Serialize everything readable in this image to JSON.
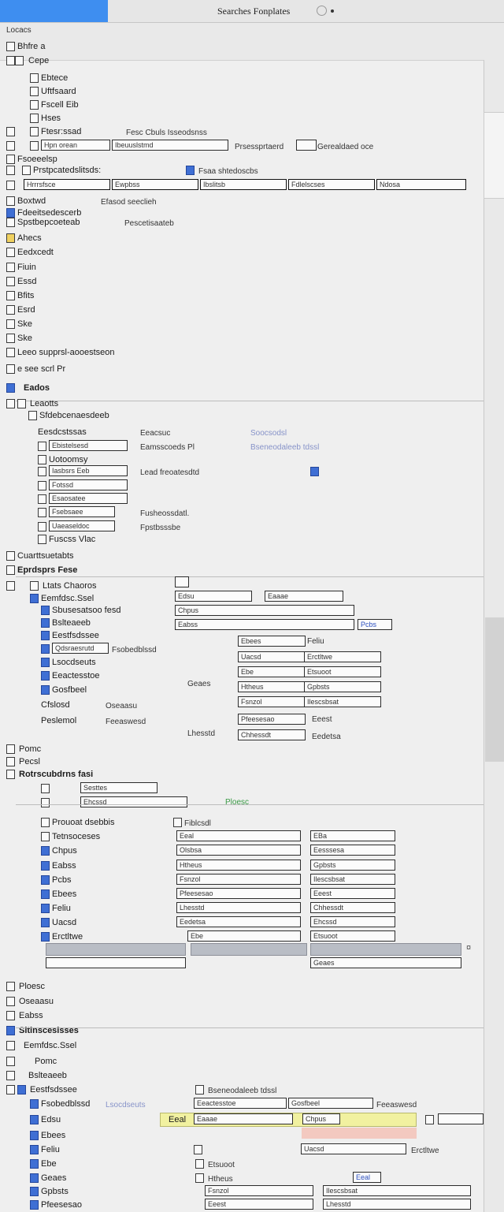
{
  "window": {
    "title": "Searches Fonplates",
    "breadcrumb": "Locacs"
  },
  "colors": {
    "accent": "#3e8ef0",
    "checked": "#3f6fd4",
    "highlight": "#f1f1a0",
    "link": "#2b4fbf"
  },
  "tree": {
    "root": "Bhfre a",
    "group": "Cepe",
    "items_a": [
      "Ebtece",
      "Uftfsaard",
      "Fscell Eib",
      "Hses",
      "Ftesr:ssad",
      "Fsoeeelsp",
      "Boxtwd"
    ],
    "items_b": [
      "Ahecs",
      "Eedxcedt",
      "Fiuin",
      "Essd",
      "Bfits",
      "Esrd",
      "Ske"
    ],
    "support_row": "Leeo supprsl-aooestseon",
    "row_b": "e see scrl Pr",
    "section_a": "Eados",
    "section_a_sub": "Leaotts",
    "section_b": "Cuarttsuetabts",
    "section_c": "Eprdsprs Fese",
    "section_c_sub": "Ltats Chaoros",
    "section_d": "Rotrscubdrns fasi",
    "section_e": "Prouoat dsebbis",
    "section_f": "Tetnsoceses",
    "section_g": "Pomc",
    "section_h": "Sitinsceslsses",
    "section_i": "Pecsl"
  },
  "fields": {
    "f1": "Hpn orean",
    "f2": "Ibeuuslstmd",
    "f3": "Hrrrsfsce",
    "f4": "Ewpbss",
    "f5": "Ibslitsb",
    "f6": "Fdlelscses",
    "f7": "Ndosa",
    "f8": "Eesdcstssas",
    "f9": "Ebistelsesd",
    "f10": "Uotoomsy",
    "f11": "Iasbsrs Eeb",
    "f12": "Fotssd",
    "f13": "Esaosatee",
    "f14": "Fsebsaee",
    "f15": "Uaeaseldoc",
    "f16": "Fuscss Vlac",
    "f17": "Qdsraesrutd",
    "f18": "Cfslosd",
    "f19": "Peslemol",
    "f20": "Sesttes"
  },
  "notes": {
    "n1": "Fesc Cbuls Isseodsnss",
    "n2": "Prsessprtaerd",
    "n3": "Gerealdaed oce",
    "n4": "Prstpcatedslitsds:",
    "n5": "Fsaa shtedoscbs",
    "n6": "Efasod seeclieh",
    "n7": "Fdeeitsedescerb",
    "n8": "Spstbepcoeteab",
    "n9": "Pescetisaateb",
    "n10": "Sfdebcenaesdeeb",
    "n11": "Eeacsuc",
    "n12": "Soocsodsl",
    "n13": "Eamsscoeds Pl",
    "n14": "Bseneodaleeb tdssl",
    "n15": "Lead freoatesdtd",
    "n16": "Fusheossdatl.",
    "n17": "Fpstbsssbe",
    "n18": "Eemfdsc.Ssel",
    "n19": "Sbusesatsoo fesd",
    "n20": "Bslteaeeb",
    "n21": "Eestfsdssee",
    "n22": "Fsobedblssd",
    "n23": "Lsocdseuts",
    "n24": "Eeactesstoe",
    "n25": "Gosfbeel",
    "n26": "Oseaasu",
    "n27": "Feeaswesd",
    "n28": "Edsu",
    "n29": "Eaaae",
    "n30": "Chpus",
    "n31": "Eabss",
    "n32": "Pcbs",
    "n33": "Ebees",
    "n34": "Feliu",
    "n35": "Uacsd",
    "n36": "Erctltwe",
    "n37": "Ebe",
    "n38": "Etsuoot",
    "n39": "Geaes",
    "n40": "Htheus",
    "n41": "Gpbsts",
    "n42": "Fsnzol",
    "n43": "Ilescsbsat",
    "n44": "Pfeesesao",
    "n45": "Eeest",
    "n46": "Lhesstd",
    "n47": "Chhessdt",
    "n48": "Eedetsa",
    "n49": "Ehcssd",
    "n50": "Ploesc",
    "n51": "Fiblcsdl",
    "n52": "Eeal",
    "n53": "EBa",
    "n54": "Olsbsa",
    "n55": "Eesssesa"
  }
}
